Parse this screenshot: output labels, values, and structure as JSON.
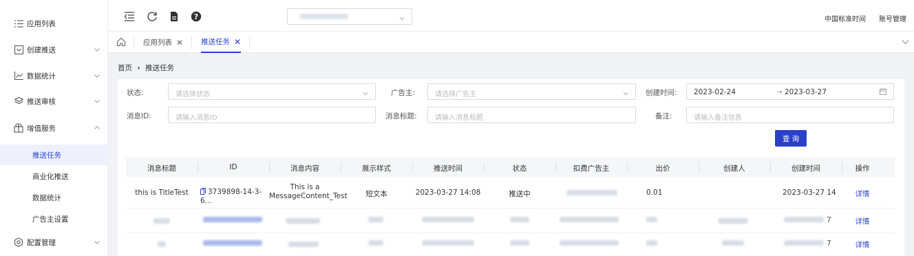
{
  "sidebar": {
    "items": [
      {
        "icon": "list-icon",
        "label": "应用列表"
      },
      {
        "icon": "message-square-icon",
        "label": "创建推送"
      },
      {
        "icon": "line-chart-icon",
        "label": "数据统计"
      },
      {
        "icon": "layers-icon",
        "label": "推送审核"
      },
      {
        "icon": "gift-icon",
        "label": "增值服务"
      },
      {
        "icon": "gear-icon",
        "label": "配置管理"
      }
    ],
    "sub_items": [
      {
        "label": "推送任务",
        "active": true
      },
      {
        "label": "商业化推送"
      },
      {
        "label": "数据统计"
      },
      {
        "label": "广告主设置"
      }
    ]
  },
  "topbar": {
    "right_time": "中国标准时间",
    "right_account": "账号管理"
  },
  "tabs": [
    {
      "label": "应用列表"
    },
    {
      "label": "推送任务",
      "active": true
    }
  ],
  "breadcrumb": {
    "home": "首页",
    "sep": "›",
    "current": "推送任务"
  },
  "filters": {
    "status_label": "状态:",
    "status_placeholder": "请选择状态",
    "advertiser_label": "广告主:",
    "advertiser_placeholder": "请选择广告主",
    "created_label": "创建时间:",
    "date_start": "2023-02-24",
    "date_arrow": "→",
    "date_end": "2023-03-27",
    "msgid_label": "消息ID:",
    "msgid_placeholder": "请输入消息ID",
    "title_label": "消息标题:",
    "title_placeholder": "请输入消息标题",
    "remark_label": "备注:",
    "remark_placeholder": "请输入备注信息",
    "query_button": "查 询"
  },
  "table": {
    "headers": [
      "消息标题",
      "ID",
      "消息内容",
      "展示样式",
      "推送时间",
      "状态",
      "扣费广告主",
      "出价",
      "创建人",
      "创建时间",
      "操作"
    ],
    "row1": {
      "title": "this is TitleTest",
      "id": "3739898-14-3-6...",
      "content_line1": "This is a",
      "content_line2": "MessageContent_Test",
      "style": "短文本",
      "push_time": "2023-03-27 14:08",
      "status": "推送中",
      "bid": "0.01",
      "created_time": "2023-03-27 14",
      "action": "详情"
    },
    "row2_action": "详情",
    "row3_action": "详情",
    "row2_time_tail": "7",
    "row3_time_tail": "7"
  },
  "colors": {
    "accent": "#2a40c9",
    "bg": "#f0f2f5"
  }
}
